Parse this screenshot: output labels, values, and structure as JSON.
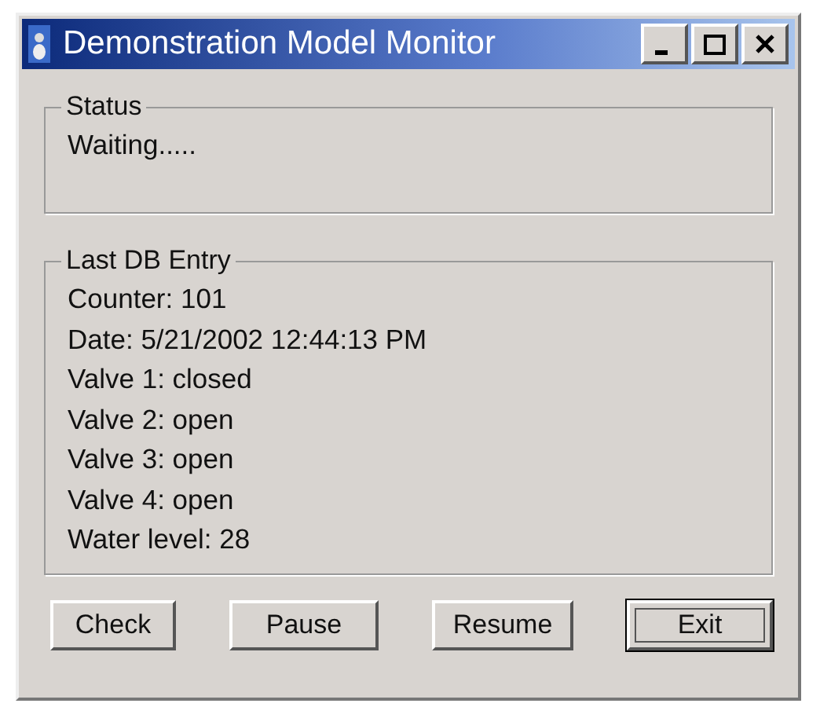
{
  "window": {
    "title": "Demonstration Model Monitor",
    "controls": [
      {
        "kind": "minimize"
      },
      {
        "kind": "maximize"
      },
      {
        "kind": "close"
      }
    ]
  },
  "status": {
    "title": "Status",
    "text": "Waiting....."
  },
  "last_entry": {
    "title": "Last DB Entry",
    "lines": [
      "Counter: 101",
      "Date: 5/21/2002 12:44:13 PM",
      "Valve 1: closed",
      "Valve 2: open",
      "Valve 3: open",
      "Valve 4: open",
      "Water level: 28"
    ]
  },
  "buttons": [
    {
      "label": "Check",
      "focused": false
    },
    {
      "label": "Pause",
      "focused": false
    },
    {
      "label": "Resume",
      "focused": false
    },
    {
      "label": "Exit",
      "focused": true
    }
  ]
}
